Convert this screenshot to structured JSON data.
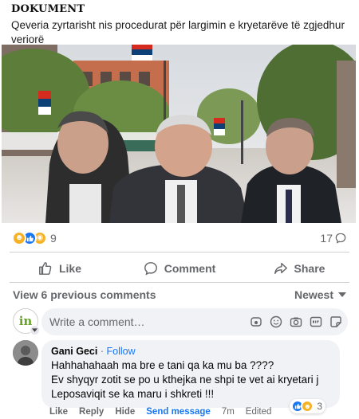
{
  "link_preview": {
    "title": "DOKUMENT",
    "subtitle": "Qeveria zyrtarisht nis procedurat për largimin e kryetarëve të zgjedhur veriorë"
  },
  "stats": {
    "reaction_icons": [
      "laugh-emoji",
      "like-thumb",
      "wow-emoji"
    ],
    "reaction_count": "9",
    "comment_count": "17"
  },
  "actions": {
    "like": "Like",
    "comment": "Comment",
    "share": "Share"
  },
  "comments_bar": {
    "view_previous": "View 6 previous comments",
    "sort": "Newest"
  },
  "composer": {
    "avatar_text": "in",
    "placeholder": "Write a comment…"
  },
  "comment": {
    "author": "Gani Geci",
    "separator": "·",
    "follow": "Follow",
    "text_lines": [
      "Hahhahahaah ma bre e tani qa ka mu ba ????",
      "Ev shyqyr zotit se po u kthejka ne shpi te vet ai kryetari j",
      "Leposaviqit se ka maru i shkreti !!!"
    ],
    "footer": {
      "like": "Like",
      "reply": "Reply",
      "hide": "Hide",
      "send_message": "Send message",
      "time": "7m",
      "edited": "Edited"
    },
    "reaction_count": "3"
  },
  "colors": {
    "accent": "#1877f2",
    "muted": "#65676b",
    "bubble": "#f0f2f5",
    "divider": "#ced0d4"
  }
}
